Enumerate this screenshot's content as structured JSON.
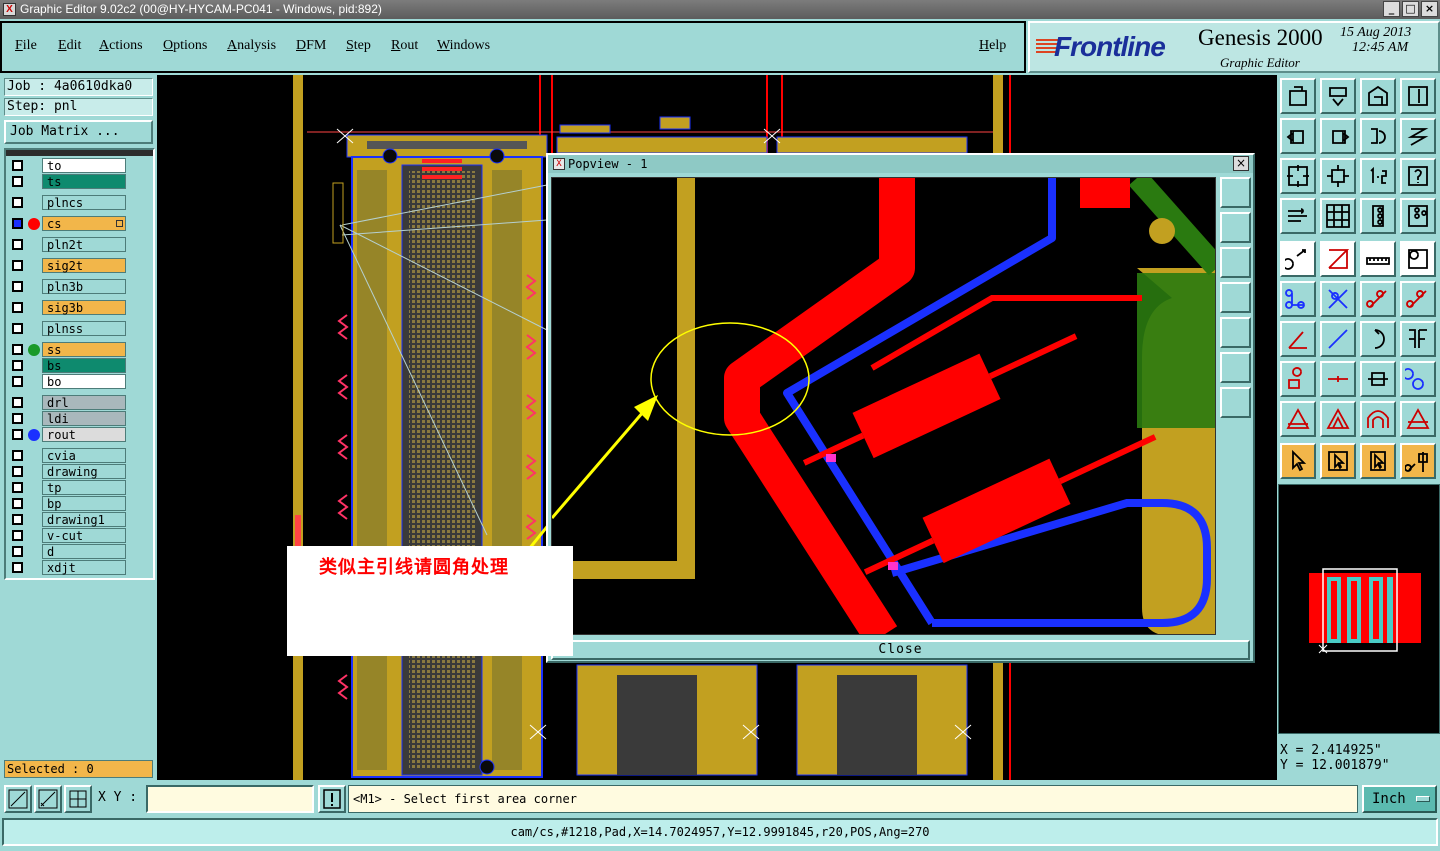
{
  "window": {
    "title": "Graphic Editor 9.02c2 (00@HY-HYCAM-PC041 - Windows, pid:892)"
  },
  "menu": [
    "File",
    "Edit",
    "Actions",
    "Options",
    "Analysis",
    "DFM",
    "Step",
    "Rout",
    "Windows"
  ],
  "help": "Help",
  "brand": {
    "logo": "Frontline",
    "product": "Genesis 2000",
    "subtitle": "Graphic Editor",
    "date": "15 Aug 2013",
    "time": "12:45 AM"
  },
  "job": {
    "job": "Job : 4a0610dka0",
    "step": "Step: pnl",
    "matrix_button": "Job Matrix ..."
  },
  "layers": [
    {
      "name": "to",
      "bg": "#ffffff",
      "dot": ""
    },
    {
      "name": "ts",
      "bg": "#0e8a6e",
      "dot": ""
    },
    {
      "name": "plncs",
      "bg": "#9fd9d6",
      "dot": ""
    },
    {
      "name": "cs",
      "bg": "#f2b64a",
      "dot": "#ff0000",
      "marker": true
    },
    {
      "name": "pln2t",
      "bg": "#9fd9d6",
      "dot": ""
    },
    {
      "name": "sig2t",
      "bg": "#f2b64a",
      "dot": ""
    },
    {
      "name": "pln3b",
      "bg": "#9fd9d6",
      "dot": ""
    },
    {
      "name": "sig3b",
      "bg": "#f2b64a",
      "dot": ""
    },
    {
      "name": "plnss",
      "bg": "#9fd9d6",
      "dot": ""
    },
    {
      "name": "ss",
      "bg": "#f2b64a",
      "dot": "#1a9a2a"
    },
    {
      "name": "bs",
      "bg": "#0e8a6e",
      "dot": ""
    },
    {
      "name": "bo",
      "bg": "#ffffff",
      "dot": ""
    },
    {
      "name": "drl",
      "bg": "#a9b8bc",
      "dot": ""
    },
    {
      "name": "ldi",
      "bg": "#a9b8bc",
      "dot": ""
    },
    {
      "name": "rout",
      "bg": "#dcdcdc",
      "dot": "#1a30ff"
    },
    {
      "name": "cvia",
      "bg": "#9fd9d6",
      "dot": ""
    },
    {
      "name": "drawing",
      "bg": "#9fd9d6",
      "dot": ""
    },
    {
      "name": "tp",
      "bg": "#9fd9d6",
      "dot": ""
    },
    {
      "name": "bp",
      "bg": "#9fd9d6",
      "dot": ""
    },
    {
      "name": "drawing1",
      "bg": "#9fd9d6",
      "dot": ""
    },
    {
      "name": "v-cut",
      "bg": "#9fd9d6",
      "dot": ""
    },
    {
      "name": "d",
      "bg": "#9fd9d6",
      "dot": ""
    },
    {
      "name": "xdjt",
      "bg": "#9fd9d6",
      "dot": ""
    }
  ],
  "selected": "Selected : 0",
  "popview": {
    "title": "Popview - 1",
    "close_button": "Close"
  },
  "annotation": "类似主引线请圆角处理",
  "coords": {
    "x": "X = 2.414925\"",
    "y": "Y = 12.001879\""
  },
  "xy_label": "X Y :",
  "xy_value": "",
  "message": "<M1> - Select first area corner",
  "unit": "Inch",
  "status": "cam/cs,#1218,Pad,X=14.7024957,Y=12.9991845,r20,POS,Ang=270",
  "colors": {
    "panel": "#9fd9d6",
    "copper": "#c2a020",
    "trace": "#ff0000",
    "rout": "#1a30ff",
    "highlight": "#f2b64a"
  }
}
